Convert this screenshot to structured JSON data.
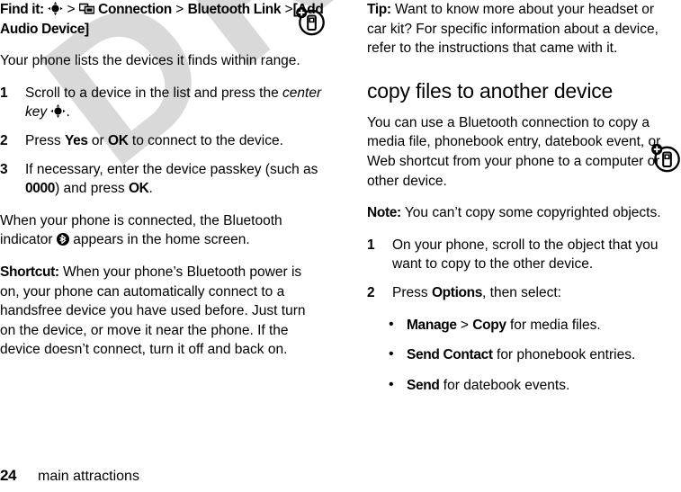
{
  "document": {
    "watermark_text": "DRAFT",
    "watermark_color": "#d9d9d9"
  },
  "footer": {
    "page_number": "24",
    "chapter": "main attractions"
  },
  "left_column": {
    "find_it": {
      "label": "Find it:",
      "sep1": ">",
      "connection_icon": "connection-icon",
      "center_key_icon": "center-key-icon",
      "item1": "Connection",
      "sep2": ">",
      "item2": "Bluetooth Link",
      "sep3": ">",
      "item3": "[Add Audio Device]"
    },
    "intro": "Your phone lists the devices it finds within range.",
    "steps": [
      {
        "num": "1",
        "pre": "Scroll to a device in the list and press the ",
        "italic": "center key",
        "post": "."
      },
      {
        "num": "2",
        "pre": "Press ",
        "bold1": "Yes",
        "mid": " or ",
        "bold2": "OK",
        "post": " to connect to the device."
      },
      {
        "num": "3",
        "pre": "If necessary, enter the device passkey (such as ",
        "bold1": "0000",
        "mid": ") and press ",
        "bold2": "OK",
        "post": "."
      }
    ],
    "connected_para": {
      "pre": "When your phone is connected, the Bluetooth indicator ",
      "bluetooth_icon": "bluetooth-indicator-icon",
      "post": " appears in the home screen."
    },
    "shortcut": {
      "label": "Shortcut:",
      "text": " When your phone’s Bluetooth power is on, your phone can automatically connect to a handsfree device you have used before. Just turn on the device, or move it near the phone. If the device doesn’t connect, turn it off and back on."
    }
  },
  "right_column": {
    "tip": {
      "label": "Tip:",
      "text": " Want to know more about your headset or car kit? For specific information about a device, refer to the instructions that came with it."
    },
    "heading": "copy files to another device",
    "intro": "You can use a Bluetooth connection to copy a media file, phonebook entry, datebook event, or Web shortcut from your phone to a computer or other device.",
    "note": {
      "label": "Note:",
      "text": " You can’t copy some copyrighted objects."
    },
    "steps": [
      {
        "num": "1",
        "text": "On your phone, scroll to the object that you want to copy to the other device."
      },
      {
        "num": "2",
        "pre": "Press ",
        "bold1": "Options",
        "post": ", then select:"
      }
    ],
    "bullets": [
      {
        "bold1": "Manage",
        "sep": " > ",
        "bold2": "Copy",
        "post": " for media files."
      },
      {
        "bold1": "Send Contact",
        "post": " for phonebook entries."
      },
      {
        "bold1": "Send",
        "post": " for datebook events."
      }
    ]
  },
  "margin_icons": {
    "find_it_icon": "add-audio-device-icon",
    "copy_files_icon": "add-audio-device-icon"
  }
}
